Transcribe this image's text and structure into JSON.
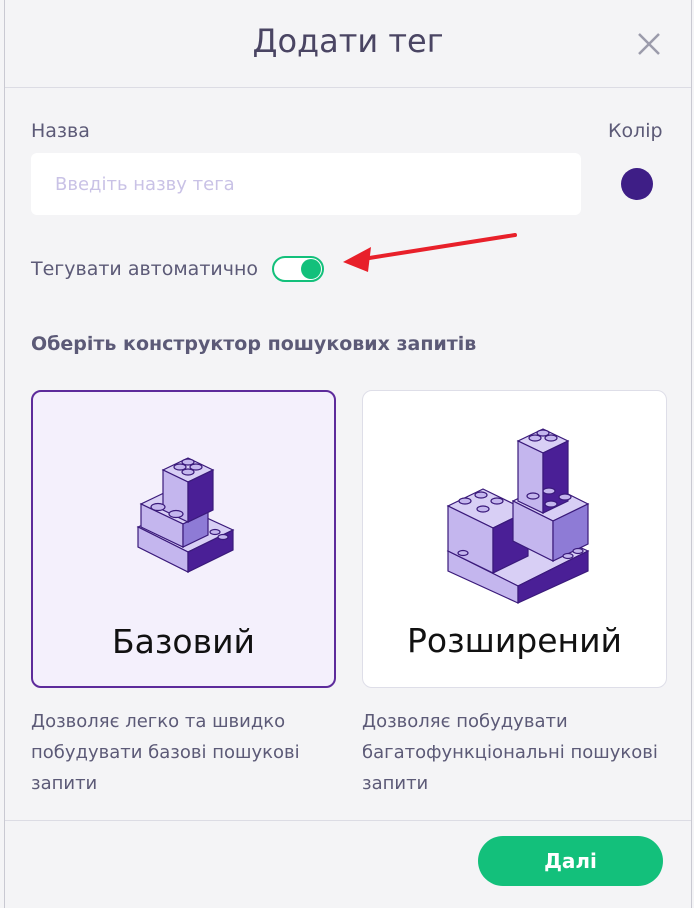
{
  "dialog": {
    "title": "Додати тег",
    "close_icon": "close-icon"
  },
  "form": {
    "name_label": "Назва",
    "name_value": "",
    "name_placeholder": "Введіть назву тега",
    "color_label": "Колір",
    "color_value": "#3e1e86",
    "auto_tag_label": "Тегувати автоматично",
    "auto_tag_enabled": true
  },
  "builder": {
    "section_title": "Оберіть конструктор пошукових запитів",
    "options": [
      {
        "label": "Базовий",
        "description": "Дозволяє легко та швидко побудувати базові пошукові запити",
        "selected": true,
        "icon": "lego-blocks-small-icon"
      },
      {
        "label": "Розширений",
        "description": "Дозволяє побудувати багатофункціональні пошукові запити",
        "selected": false,
        "icon": "lego-blocks-large-icon"
      }
    ]
  },
  "footer": {
    "next_label": "Далі"
  },
  "colors": {
    "accent_green": "#13c07b",
    "accent_purple": "#5d2b9b",
    "annotation_arrow": "#e8202a"
  }
}
